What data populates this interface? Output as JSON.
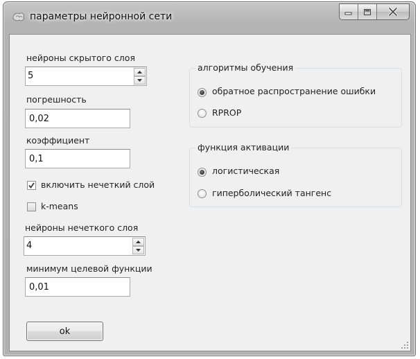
{
  "window": {
    "title": "параметры нейронной сети",
    "colors": {
      "frame": "#b4b4b4",
      "client": "#f0f0f0",
      "group_border": "#d5dfe5"
    }
  },
  "hidden_neurons": {
    "label": "нейроны скрытого слоя",
    "value": "5"
  },
  "error": {
    "label": "погрешность",
    "value": "0,02"
  },
  "coefficient": {
    "label": "коэффициент",
    "value": "0,1"
  },
  "fuzzy_layer": {
    "label": "включить нечеткий слой",
    "checked": true
  },
  "kmeans": {
    "label": "k-means",
    "checked": false
  },
  "fuzzy_neurons": {
    "label": "нейроны нечеткого слоя",
    "value": "4"
  },
  "min_target": {
    "label": "минимум целевой функции",
    "value": "0,01"
  },
  "ok_label": "ok",
  "training": {
    "title": "алгоритмы обучения",
    "options": [
      {
        "label": "обратное распространение ошибки",
        "selected": true
      },
      {
        "label": "RPROP",
        "selected": false
      }
    ]
  },
  "activation": {
    "title": "функция активации",
    "options": [
      {
        "label": "логистическая",
        "selected": true
      },
      {
        "label": "гиперболический тангенс",
        "selected": false
      }
    ]
  },
  "icons": {
    "app": "app-icon",
    "minimize": "minimize-icon",
    "maximize": "maximize-icon",
    "close": "close-icon",
    "up": "spin-up-icon",
    "down": "spin-down-icon",
    "check": "check-icon",
    "grip": "resize-grip-icon"
  }
}
